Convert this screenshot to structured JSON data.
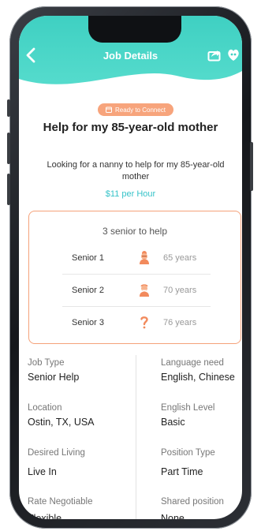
{
  "header": {
    "title": "Job Details"
  },
  "job": {
    "badge": "Ready to Connect",
    "title": "Help for my 85-year-old mother",
    "description": "Looking for a nanny to help for my 85-year-old mother",
    "rate": "$11 per Hour"
  },
  "seniors": {
    "title": "3 senior to help",
    "items": [
      {
        "label": "Senior 1",
        "age": "65 years",
        "icon": "female-senior-icon"
      },
      {
        "label": "Senior 2",
        "age": "70 years",
        "icon": "male-senior-icon"
      },
      {
        "label": "Senior 3",
        "age": "76 years",
        "icon": "question-mark-icon"
      }
    ]
  },
  "details": {
    "job_type": {
      "label": "Job Type",
      "value": "Senior Help"
    },
    "language": {
      "label": "Language need",
      "value": "English, Chinese"
    },
    "location": {
      "label": "Location",
      "value": "Ostin, TX, USA"
    },
    "english_level": {
      "label": "English Level",
      "value": "Basic"
    },
    "desired_living": {
      "label": "Desired Living",
      "value": "Live In"
    },
    "position_type": {
      "label": "Position Type",
      "value": "Part Time"
    },
    "rate_negotiable": {
      "label": "Rate Negotiable",
      "value": "Flexible"
    },
    "shared_position": {
      "label": "Shared position",
      "value": "None"
    }
  },
  "colors": {
    "accent_teal": "#3fd0c2",
    "accent_orange": "#f5a27a",
    "rate_blue": "#36c3c9"
  }
}
